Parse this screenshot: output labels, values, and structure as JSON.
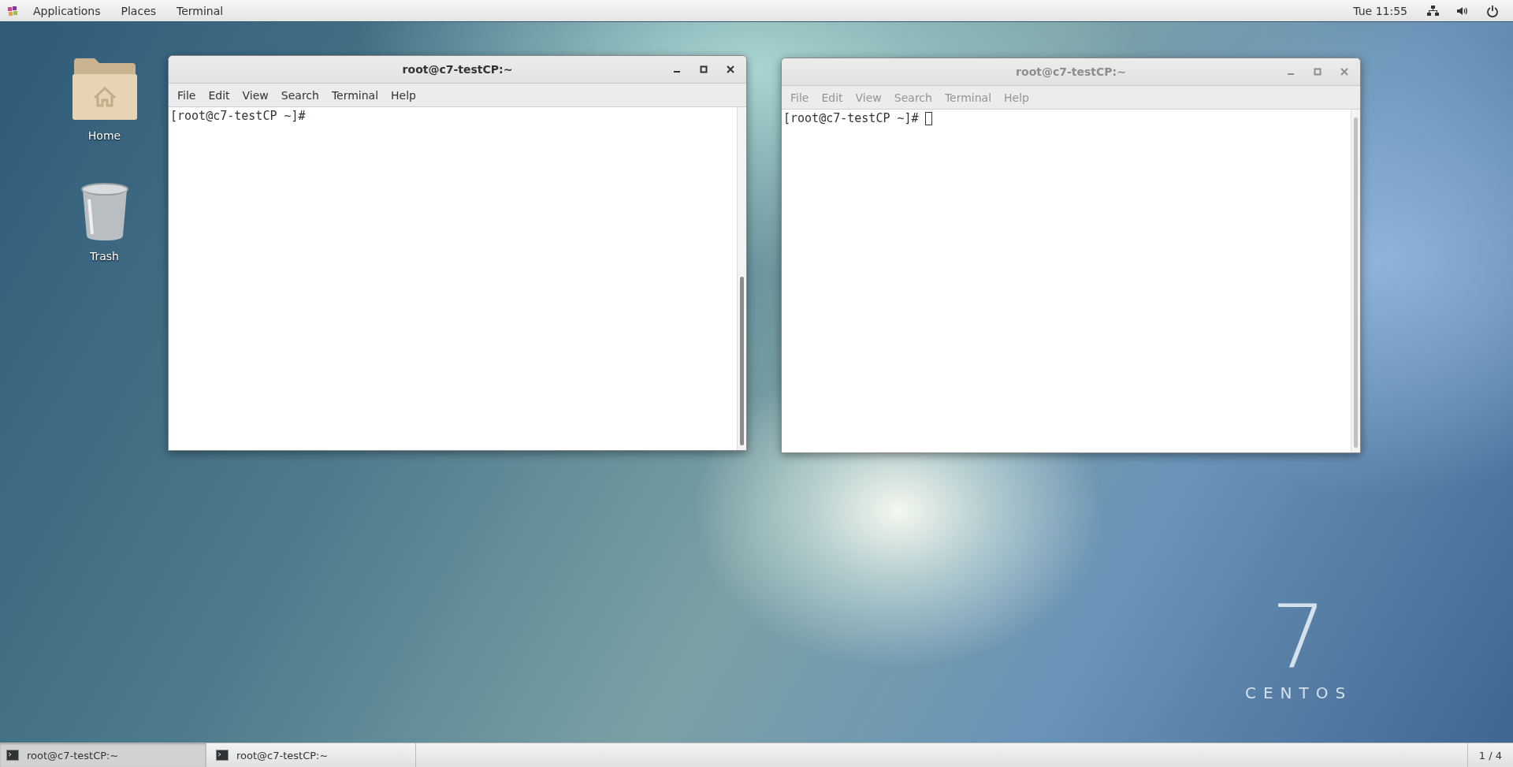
{
  "top_bar": {
    "menus": [
      "Applications",
      "Places",
      "Terminal"
    ],
    "clock": "Tue 11:55"
  },
  "desktop_icons": [
    {
      "kind": "folder",
      "label": "Home"
    },
    {
      "kind": "trash",
      "label": "Trash"
    }
  ],
  "wallpaper": {
    "number": "7",
    "name": "CENTOS"
  },
  "windows": [
    {
      "title": "root@c7-testCP:~",
      "focused": true,
      "menu": [
        "File",
        "Edit",
        "View",
        "Search",
        "Terminal",
        "Help"
      ],
      "lines": [
        "[root@c7-testCP ~]#"
      ],
      "cursor": false
    },
    {
      "title": "root@c7-testCP:~",
      "focused": false,
      "menu": [
        "File",
        "Edit",
        "View",
        "Search",
        "Terminal",
        "Help"
      ],
      "lines": [
        "[root@c7-testCP ~]#"
      ],
      "cursor": true
    }
  ],
  "taskbar": {
    "items": [
      {
        "label": "root@c7-testCP:~",
        "selected": true
      },
      {
        "label": "root@c7-testCP:~",
        "selected": false
      }
    ],
    "workspace": "1 / 4"
  }
}
